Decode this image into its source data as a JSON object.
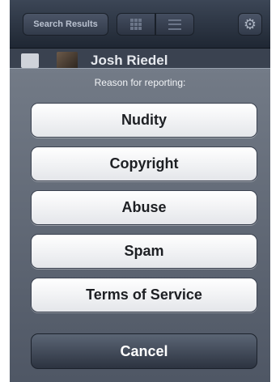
{
  "navbar": {
    "search_results_label": "Search Results",
    "grid_icon": "grid-icon",
    "list_icon": "list-icon",
    "settings_icon": "gear-icon",
    "settings_glyph": "⚙"
  },
  "profile": {
    "name": "Josh Riedel"
  },
  "action_sheet": {
    "title": "Reason for reporting:",
    "options": [
      {
        "label": "Nudity"
      },
      {
        "label": "Copyright"
      },
      {
        "label": "Abuse"
      },
      {
        "label": "Spam"
      },
      {
        "label": "Terms of Service"
      }
    ],
    "cancel_label": "Cancel"
  },
  "colors": {
    "sheet_bg": "#6f7889",
    "button_bg": "#ffffff",
    "cancel_bg": "#3a4352"
  }
}
